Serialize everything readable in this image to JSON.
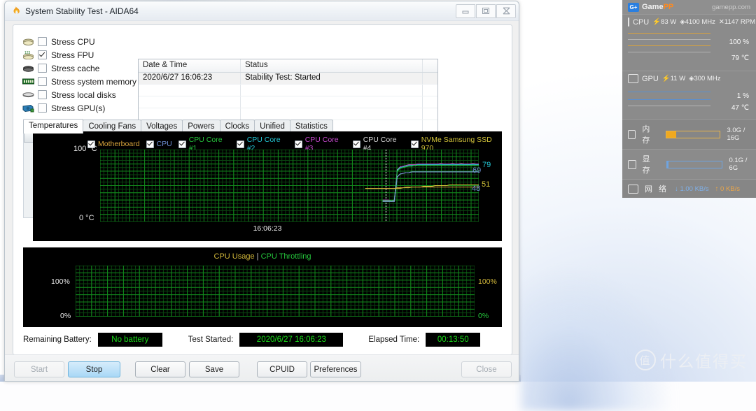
{
  "window": {
    "title": "System Stability Test - AIDA64",
    "icon": "aida64-flame-icon",
    "controls": {
      "minimize": "—",
      "maximize": "❐",
      "close": "✕"
    }
  },
  "stress_options": [
    {
      "label": "Stress CPU",
      "checked": false,
      "icon": "cpu-chip-icon"
    },
    {
      "label": "Stress FPU",
      "checked": true,
      "icon": "fpu-chip-icon"
    },
    {
      "label": "Stress cache",
      "checked": false,
      "icon": "cache-chip-icon"
    },
    {
      "label": "Stress system memory",
      "checked": false,
      "icon": "memory-module-icon"
    },
    {
      "label": "Stress local disks",
      "checked": false,
      "icon": "hard-disk-icon"
    },
    {
      "label": "Stress GPU(s)",
      "checked": false,
      "icon": "gpu-card-icon"
    }
  ],
  "log": {
    "columns": [
      "Date & Time",
      "Status",
      ""
    ],
    "rows": [
      {
        "datetime": "2020/6/27 16:06:23",
        "status": "Stability Test: Started"
      }
    ],
    "empty_rows": 5
  },
  "tabs": [
    {
      "label": "Temperatures",
      "active": true
    },
    {
      "label": "Cooling Fans",
      "active": false
    },
    {
      "label": "Voltages",
      "active": false
    },
    {
      "label": "Powers",
      "active": false
    },
    {
      "label": "Clocks",
      "active": false
    },
    {
      "label": "Unified",
      "active": false
    },
    {
      "label": "Statistics",
      "active": false
    }
  ],
  "temp_legend": [
    {
      "label": "Motherboard",
      "color": "#d9a63c",
      "checked": true
    },
    {
      "label": "CPU",
      "color": "#6e8fd4",
      "checked": true
    },
    {
      "label": "CPU Core #1",
      "color": "#25c63c",
      "checked": true
    },
    {
      "label": "CPU Core #2",
      "color": "#23c7d6",
      "checked": true
    },
    {
      "label": "CPU Core #3",
      "color": "#c84ad0",
      "checked": true
    },
    {
      "label": "CPU Core #4",
      "color": "#d8d8d8",
      "checked": true
    },
    {
      "label": "NVMe Samsung SSD 970",
      "color": "#d2c33a",
      "checked": true
    }
  ],
  "chart_data": [
    {
      "type": "line",
      "title": "Temperatures",
      "ylabel": "°C",
      "ytick_top": "100 °C",
      "ytick_bottom": "0 °C",
      "ylim": [
        0,
        100
      ],
      "xlabel": "16:06:23",
      "grid": true,
      "grid_color": "#0d5c14",
      "background": "#000000",
      "marker_line_time": "16:06:23",
      "end_labels": [
        {
          "value": "79",
          "color": "#23c7d6"
        },
        {
          "value": "69",
          "color": "#6e8fd4"
        },
        {
          "value": "48",
          "color": "#6e8fd4"
        },
        {
          "value": "51",
          "color": "#d2c33a"
        }
      ],
      "series": [
        {
          "name": "CPU Core #3",
          "color": "#c84ad0",
          "values": [
            null,
            null,
            null,
            null,
            null,
            null,
            30,
            30,
            30,
            29,
            30,
            72,
            76,
            77,
            78,
            79,
            79,
            79,
            80,
            80,
            80,
            80,
            80,
            80,
            80,
            80,
            81,
            80,
            80,
            80,
            81,
            80,
            80,
            81,
            80,
            80,
            80,
            81,
            80,
            80
          ]
        },
        {
          "name": "CPU Core #2",
          "color": "#23c7d6",
          "values": [
            null,
            null,
            null,
            null,
            null,
            null,
            29,
            29,
            29,
            29,
            29,
            71,
            75,
            76,
            77,
            78,
            78,
            78,
            79,
            79,
            79,
            79,
            79,
            79,
            79,
            79,
            79,
            79,
            79,
            79,
            79,
            79,
            79,
            79,
            79,
            79,
            79,
            79,
            79,
            79
          ]
        },
        {
          "name": "CPU Core #1",
          "color": "#25c63c",
          "values": [
            null,
            null,
            null,
            null,
            null,
            null,
            29,
            29,
            29,
            29,
            29,
            70,
            74,
            75,
            76,
            77,
            77,
            78,
            78,
            78,
            78,
            78,
            78,
            78,
            78,
            78,
            78,
            78,
            78,
            78,
            78,
            78,
            78,
            78,
            78,
            78,
            78,
            78,
            78,
            78
          ]
        },
        {
          "name": "CPU Core #4",
          "color": "#d8d8d8",
          "values": [
            null,
            null,
            null,
            null,
            null,
            null,
            28,
            28,
            28,
            28,
            28,
            62,
            66,
            67,
            68,
            68,
            69,
            69,
            69,
            69,
            69,
            69,
            69,
            69,
            69,
            69,
            69,
            69,
            69,
            69,
            69,
            69,
            69,
            69,
            69,
            69,
            69,
            69,
            69,
            69
          ]
        },
        {
          "name": "CPU",
          "color": "#6e8fd4",
          "values": [
            null,
            null,
            null,
            null,
            null,
            null,
            28,
            28,
            28,
            28,
            28,
            62,
            66,
            67,
            68,
            68,
            69,
            69,
            69,
            69,
            69,
            69,
            69,
            69,
            69,
            69,
            69,
            69,
            69,
            69,
            69,
            69,
            69,
            69,
            69,
            69,
            69,
            69,
            69,
            69
          ]
        },
        {
          "name": "NVMe Samsung SSD 970",
          "color": "#d2c33a",
          "values": [
            46,
            46,
            46,
            46,
            46,
            46,
            46,
            46,
            46,
            46,
            46,
            46,
            46,
            47,
            47,
            47,
            48,
            48,
            48,
            48,
            49,
            49,
            49,
            49,
            50,
            50,
            50,
            50,
            50,
            51,
            51,
            51,
            51,
            51,
            51,
            51,
            51,
            51,
            51,
            51
          ]
        },
        {
          "name": "Motherboard",
          "color": "#d9a63c",
          "values": [
            46,
            46,
            46,
            46,
            46,
            46,
            46,
            46,
            46,
            46,
            46,
            47,
            47,
            47,
            48,
            48,
            48,
            48,
            48,
            48,
            48,
            48,
            48,
            48,
            48,
            48,
            48,
            48,
            48,
            48,
            48,
            48,
            48,
            48,
            48,
            48,
            48,
            48,
            48,
            48
          ]
        }
      ]
    },
    {
      "type": "line",
      "title_parts": [
        {
          "text": "CPU Usage",
          "color": "#d2b83a"
        },
        {
          "text": "|",
          "color": "#cccccc"
        },
        {
          "text": "CPU Throttling",
          "color": "#25c63c"
        }
      ],
      "ylim": [
        0,
        100
      ],
      "yticks_left": [
        "100%",
        "0%"
      ],
      "yticks_right": [
        "100%",
        "0%"
      ],
      "ytick_top_color": "#d2b83a",
      "ytick_bottom_color": "#25c63c",
      "grid": true,
      "grid_color": "#0d5c14",
      "background": "#000000",
      "series": [
        {
          "name": "CPU Usage",
          "color": "#d2b83a",
          "values": [
            0,
            0,
            0,
            0,
            0,
            0,
            0,
            0,
            0,
            0
          ]
        },
        {
          "name": "CPU Throttling",
          "color": "#25c63c",
          "values": [
            0,
            0,
            0,
            0,
            0,
            0,
            0,
            0,
            0,
            0
          ]
        }
      ]
    }
  ],
  "status": {
    "battery_label": "Remaining Battery:",
    "battery_value": "No battery",
    "started_label": "Test Started:",
    "started_value": "2020/6/27 16:06:23",
    "elapsed_label": "Elapsed Time:",
    "elapsed_value": "00:13:50",
    "value_color": "#19e019"
  },
  "buttons": [
    {
      "label": "Start",
      "state": "disabled"
    },
    {
      "label": "Stop",
      "state": "primary"
    },
    {
      "label": "Clear",
      "state": "normal"
    },
    {
      "label": "Save",
      "state": "normal"
    },
    {
      "label": "CPUID",
      "state": "normal"
    },
    {
      "label": "Preferences",
      "state": "normal"
    },
    {
      "label": "Close",
      "state": "disabled"
    }
  ],
  "gamepp": {
    "brand_left": "Game",
    "brand_right": "PP",
    "logo": "G+",
    "site": "gamepp.com",
    "cpu": {
      "name": "CPU",
      "power": "83 W",
      "clock": "4100 MHz",
      "fan": "1147 RPM",
      "usage": "100 %",
      "temp": "79 ℃",
      "usage_pct": 100,
      "temp_pct": 79
    },
    "gpu": {
      "name": "GPU",
      "power": "11 W",
      "clock": "300 MHz",
      "usage": "1 %",
      "temp": "47 ℃",
      "usage_pct": 1,
      "temp_pct": 47
    },
    "memory": {
      "label": "内 存",
      "value": "3.0G / 16G",
      "pct": 19
    },
    "vram": {
      "label": "显 存",
      "value": "0.1G / 6G",
      "pct": 3
    },
    "network": {
      "label": "网 络",
      "down": "1.00 KB/s",
      "up": "0 KB/s"
    }
  },
  "watermark": {
    "mark": "值",
    "text": "什么值得买"
  }
}
